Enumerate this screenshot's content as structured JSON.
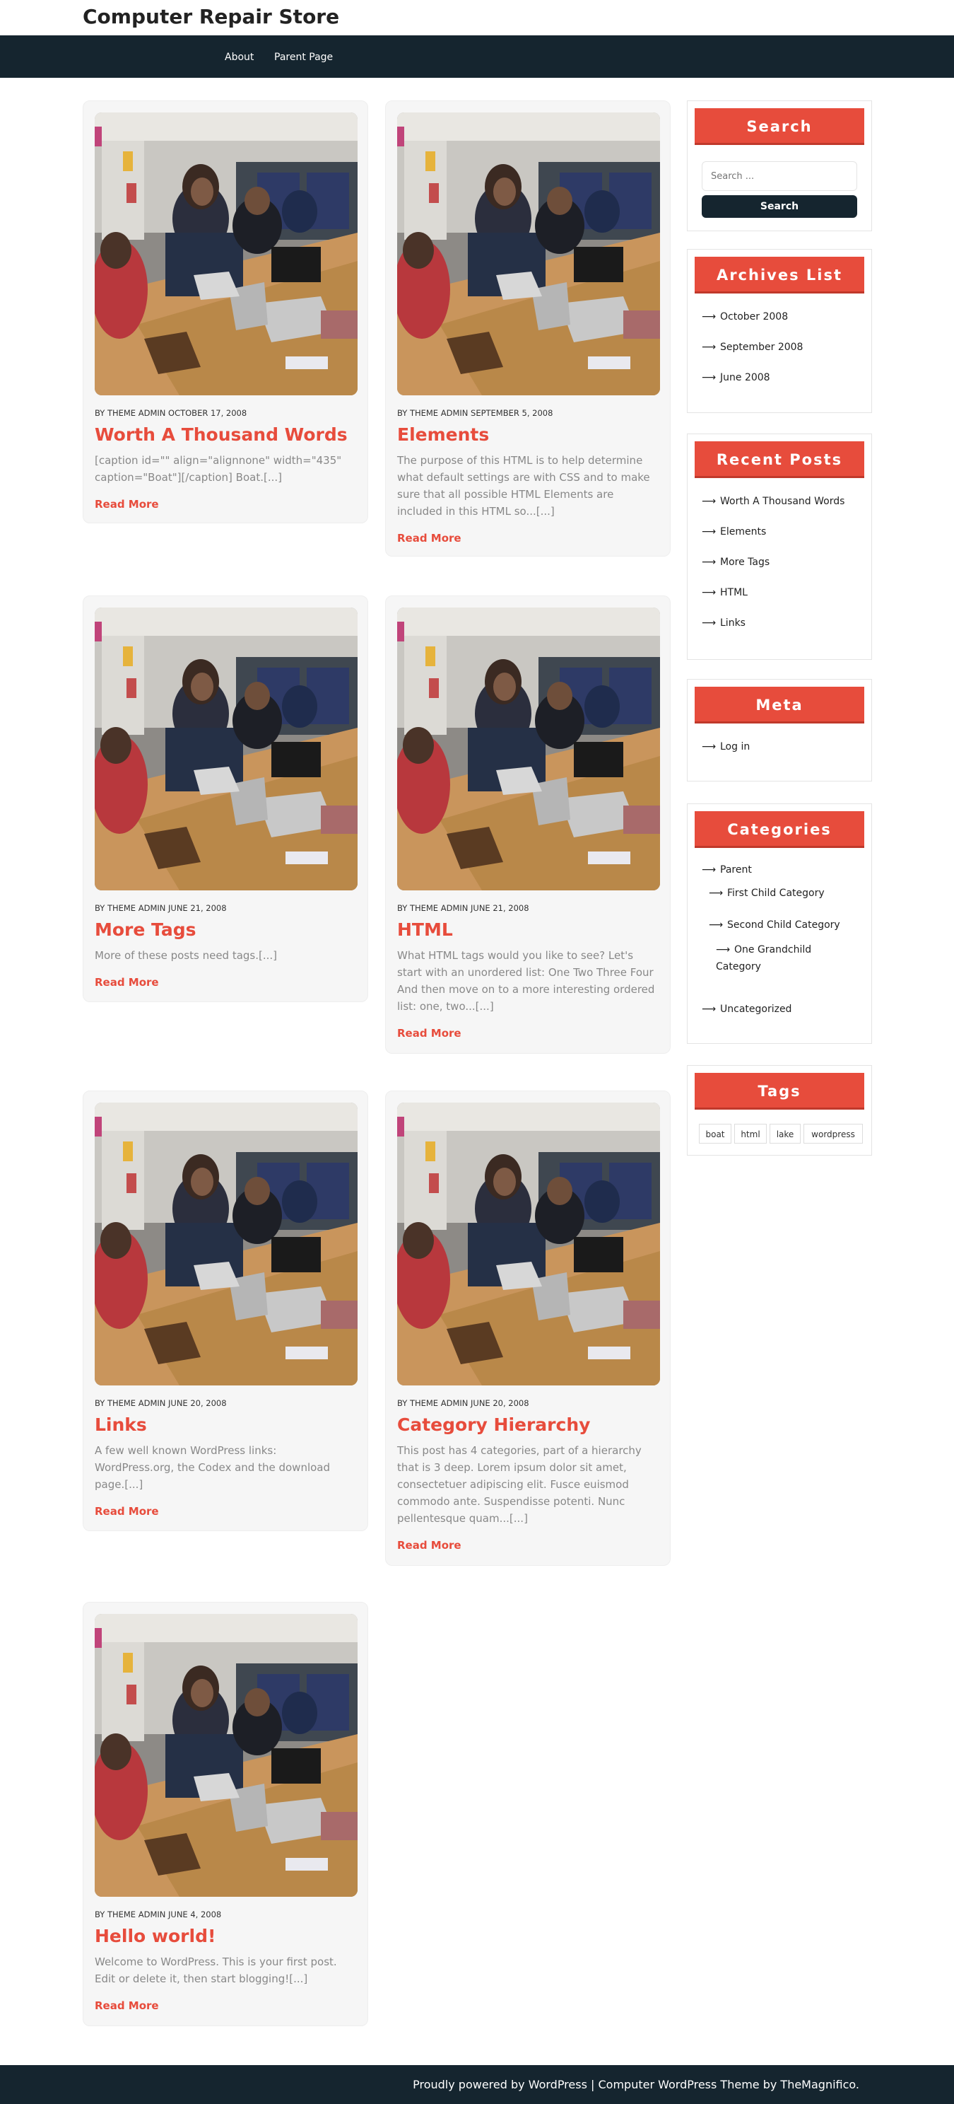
{
  "site": {
    "title": "Computer Repair Store"
  },
  "nav": {
    "items": [
      {
        "label": "About"
      },
      {
        "label": "Parent Page"
      }
    ]
  },
  "posts": [
    {
      "meta": "BY THEME ADMIN OCTOBER 17, 2008",
      "title": "Worth A Thousand Words",
      "excerpt": "[caption id=\"\" align=\"alignnone\" width=\"435\" caption=\"Boat\"][/caption] Boat.[...]",
      "read_more": "Read More"
    },
    {
      "meta": "BY THEME ADMIN SEPTEMBER 5, 2008",
      "title": "Elements",
      "excerpt": "The purpose of this HTML is to help determine what default settings are with CSS and to make sure that all possible HTML Elements are included in this HTML so...[...]",
      "read_more": "Read More"
    },
    {
      "meta": "BY THEME ADMIN JUNE 21, 2008",
      "title": "More Tags",
      "excerpt": "More of these posts need tags.[...]",
      "read_more": "Read More"
    },
    {
      "meta": "BY THEME ADMIN JUNE 21, 2008",
      "title": "HTML",
      "excerpt": "What HTML tags would you like to see? Let's start with an unordered list: One Two Three Four And then move on to a more interesting ordered list: one, two...[...]",
      "read_more": "Read More"
    },
    {
      "meta": "BY THEME ADMIN JUNE 20, 2008",
      "title": "Links",
      "excerpt": "A few well known WordPress links: WordPress.org, the Codex and the download page.[...]",
      "read_more": "Read More"
    },
    {
      "meta": "BY THEME ADMIN JUNE 20, 2008",
      "title": "Category Hierarchy",
      "excerpt": "This post has 4 categories, part of a hierarchy that is 3 deep. Lorem ipsum dolor sit amet, consectetuer adipiscing elit. Fusce euismod commodo ante. Suspendisse potenti. Nunc pellentesque quam...[...]",
      "read_more": "Read More"
    },
    {
      "meta": "BY THEME ADMIN JUNE 4, 2008",
      "title": "Hello world!",
      "excerpt": "Welcome to WordPress. This is your first post. Edit or delete it, then start blogging![...]",
      "read_more": "Read More"
    }
  ],
  "sidebar": {
    "search": {
      "title": "Search",
      "placeholder": "Search ...",
      "button": "Search"
    },
    "archives": {
      "title": "Archives List",
      "items": [
        "October 2008",
        "September 2008",
        "June 2008"
      ]
    },
    "recent": {
      "title": "Recent Posts",
      "items": [
        "Worth A Thousand Words",
        "Elements",
        "More Tags",
        "HTML",
        "Links"
      ]
    },
    "meta": {
      "title": "Meta",
      "items": [
        "Log in"
      ]
    },
    "categories": {
      "title": "Categories",
      "items": [
        "Parent",
        "First Child Category",
        "Second Child Category",
        "One Grandchild Category",
        "Uncategorized"
      ]
    },
    "tags": {
      "title": "Tags",
      "items": [
        "boat",
        "html",
        "lake",
        "wordpress"
      ]
    }
  },
  "footer": {
    "text": "Proudly powered by WordPress | Computer WordPress Theme by TheMagnifico."
  },
  "colors": {
    "accent": "#e74c3c",
    "dark": "#15252f",
    "card": "#f6f6f6"
  },
  "icons": {
    "list_bullet": "arrow-right-icon"
  }
}
